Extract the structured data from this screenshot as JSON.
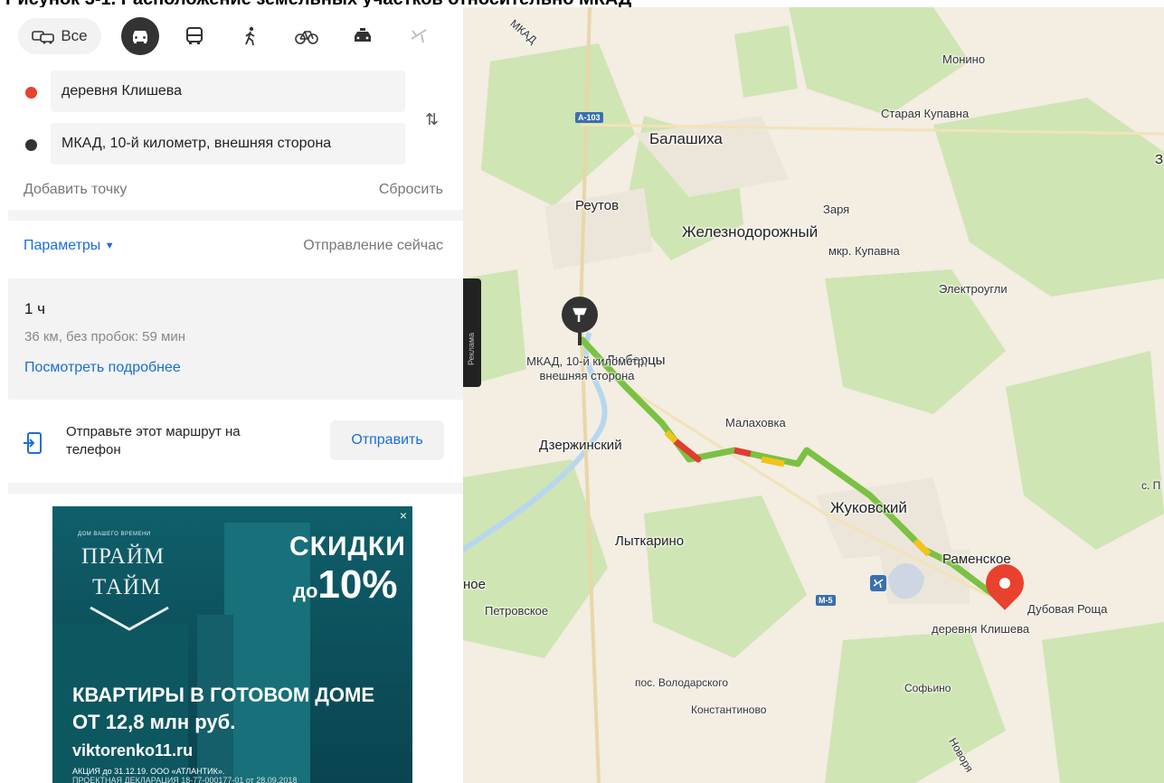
{
  "caption": "Рисунок 3-1. Расположение земельных участков относительно МКАД",
  "modes": {
    "all_label": "Все",
    "items": [
      "all-icon",
      "car-icon",
      "bus-icon",
      "walk-icon",
      "bike-icon",
      "taxi-icon",
      "plane-icon"
    ]
  },
  "route": {
    "from": "деревня Клишева",
    "to": "МКАД, 10-й километр, внешняя сторона",
    "from_color": "#e8412d",
    "to_color": "#333333",
    "swap": "⇅",
    "add_point": "Добавить точку",
    "reset": "Сбросить"
  },
  "params": {
    "label": "Параметры",
    "arrow": "▼",
    "departure": "Отправление сейчас"
  },
  "result": {
    "time": "1 ч",
    "distance": "36 км, без пробок: 59 мин",
    "details": "Посмотреть подробнее"
  },
  "send": {
    "text": "Отправьте этот маршрут на телефон",
    "button": "Отправить"
  },
  "ad": {
    "tiny": "ДОМ ВАШЕГО ВРЕМЕНИ",
    "brand1": "ПРАЙМ",
    "brand2": "ТАЙМ",
    "sale": "СКИДКИ",
    "up_to": "до",
    "discount": "10%",
    "flats": "КВАРТИРЫ В ГОТОВОМ ДОМЕ",
    "price": "ОТ 12,8 млн руб.",
    "site": "viktorenko11.ru",
    "legal1": "АКЦИЯ до 31.12.19. ООО «АТЛАНТИК».",
    "legal2": "ПРОЕКТНАЯ ДЕКЛАРАЦИЯ 18-77-000177-01 от 28.09.2018",
    "close": "×",
    "tag": "Реклама"
  },
  "map": {
    "places": [
      {
        "name": "МКАД",
        "cls": "xs"
      },
      {
        "name": "Монино",
        "cls": "sm"
      },
      {
        "name": "Старая Купавна",
        "cls": "sm"
      },
      {
        "name": "Балашиха",
        "cls": "big"
      },
      {
        "name": "Реутов",
        "cls": "med"
      },
      {
        "name": "Заря",
        "cls": "sm"
      },
      {
        "name": "Железнодорожный",
        "cls": "big"
      },
      {
        "name": "мкр. Купавна",
        "cls": "sm"
      },
      {
        "name": "Электроугли",
        "cls": "sm"
      },
      {
        "name": "Люберцы",
        "cls": "med"
      },
      {
        "name": "Малаховка",
        "cls": "sm"
      },
      {
        "name": "Дзержинский",
        "cls": "med"
      },
      {
        "name": "Жуковский",
        "cls": "big"
      },
      {
        "name": "Лыткарино",
        "cls": "med"
      },
      {
        "name": "Раменское",
        "cls": "med"
      },
      {
        "name": "Петровское",
        "cls": "sm"
      },
      {
        "name": "Дубовая Роща",
        "cls": "sm"
      },
      {
        "name": "деревня Клишева",
        "cls": "sm"
      },
      {
        "name": "пос. Володарского",
        "cls": "xs"
      },
      {
        "name": "Софьино",
        "cls": "xs"
      },
      {
        "name": "Константиново",
        "cls": "xs"
      },
      {
        "name": "ное",
        "cls": "med"
      },
      {
        "name": "с. П",
        "cls": "xs"
      },
      {
        "name": "Новоря",
        "cls": "xs"
      },
      {
        "name": "З",
        "cls": "med"
      }
    ],
    "shields": [
      "А-103",
      "М-5"
    ],
    "start_label": "МКАД, 10-й километр, внешняя сторона",
    "end_label": "деревня Клишева"
  }
}
